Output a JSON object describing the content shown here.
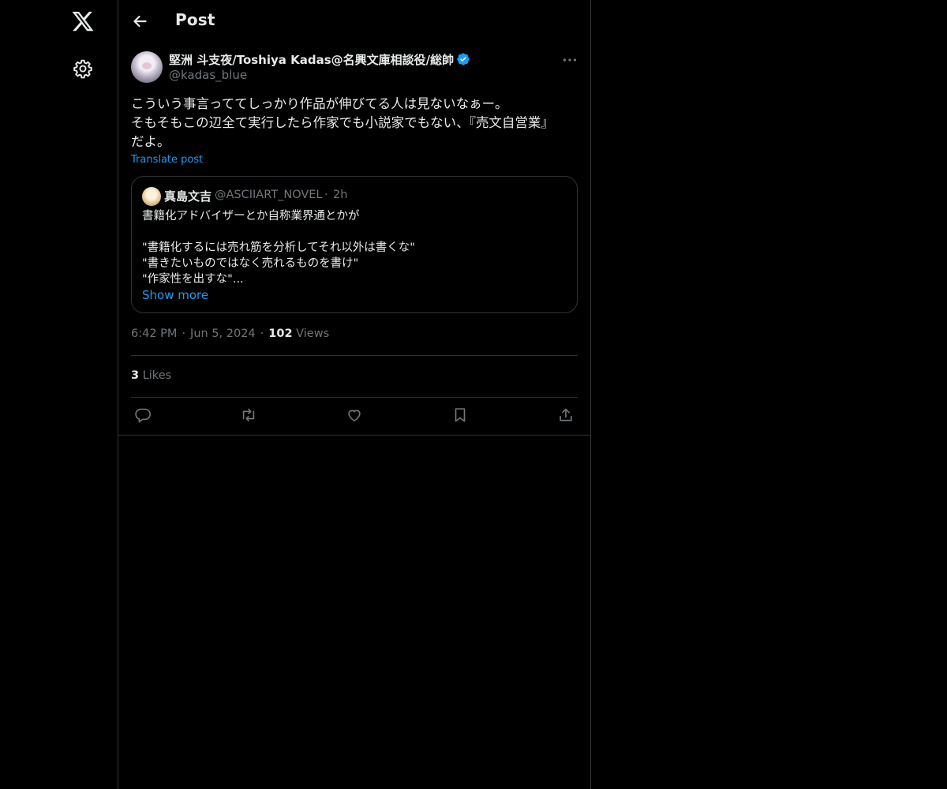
{
  "header": {
    "title": "Post"
  },
  "author": {
    "name": "堅洲 斗支夜/Toshiya Kadas@名興文庫相談役/総帥",
    "handle": "@kadas_blue"
  },
  "post": {
    "lines": [
      "こういう事言っててしっかり作品が伸びてる人は見ないなぁー。",
      "そもそもこの辺全て実行したら作家でも小説家でもない、『売文自営業』",
      "だよ。"
    ],
    "translate_label": "Translate post"
  },
  "quote": {
    "name": "真島文吉",
    "handle": "@ASCIIART_NOVEL",
    "time": "2h",
    "lines": [
      "書籍化アドバイザーとか自称業界通とかが",
      "",
      "\"書籍化するには売れ筋を分析してそれ以外は書くな\"",
      "\"書きたいものではなく売れるものを書け\"",
      "\"作家性を出すな\"..."
    ],
    "show_more": "Show more"
  },
  "meta": {
    "time": "6:42 PM",
    "date": "Jun 5, 2024",
    "views_count": "102",
    "views_label": "Views"
  },
  "likes": {
    "count": "3",
    "label": "Likes"
  },
  "actions": {
    "icons": [
      "reply-icon",
      "repost-icon",
      "like-icon",
      "bookmark-icon",
      "share-icon"
    ]
  },
  "colors": {
    "background": "#000000",
    "text": "#e7e9ea",
    "muted": "#71767b",
    "accent": "#1d9bf0",
    "border": "#2f3336"
  }
}
